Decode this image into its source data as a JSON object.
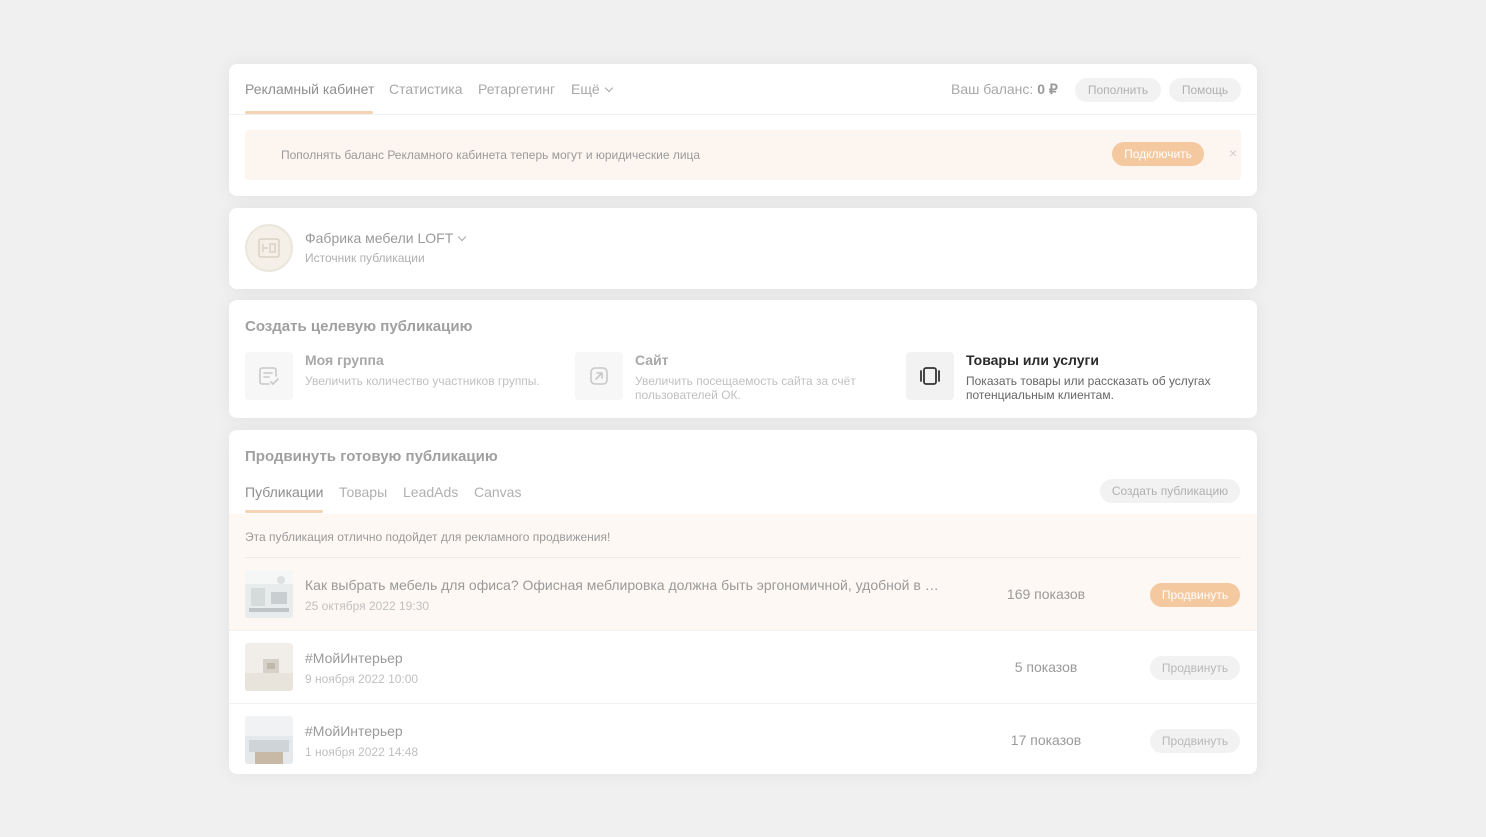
{
  "nav": {
    "tabs": [
      {
        "label": "Рекламный кабинет"
      },
      {
        "label": "Статистика"
      },
      {
        "label": "Ретаргетинг"
      },
      {
        "label": "Ещё"
      }
    ],
    "balance_label": "Ваш баланс:",
    "balance_value": "0 ₽",
    "topup_label": "Пополнить",
    "help_label": "Помощь"
  },
  "banner": {
    "text": "Пополнять баланс Рекламного кабинета теперь могут и юридические лица",
    "button_label": "Подключить",
    "close_glyph": "×"
  },
  "source": {
    "name": "Фабрика мебели LOFT",
    "subtitle": "Источник публикации"
  },
  "create": {
    "title": "Создать целевую публикацию",
    "options": [
      {
        "title": "Моя группа",
        "desc": "Увеличить количество участников группы.",
        "icon": "group-check-icon"
      },
      {
        "title": "Сайт",
        "desc": "Увеличить посещаемость сайта за счёт пользователей ОК.",
        "icon": "external-link-icon"
      },
      {
        "title": "Товары или услуги",
        "desc": "Показать товары или рассказать об услугах потенциальным клиентам.",
        "icon": "carousel-icon"
      }
    ]
  },
  "promote": {
    "title": "Продвинуть готовую публикацию",
    "tabs": [
      {
        "label": "Публикации"
      },
      {
        "label": "Товары"
      },
      {
        "label": "LeadAds"
      },
      {
        "label": "Canvas"
      }
    ],
    "create_button": "Создать публикацию",
    "hint": "Эта публикация отлично подойдет для рекламного продвижения!",
    "rows": [
      {
        "title": "Как выбрать мебель для офиса? Офисная меблировка должна быть эргономичной, удобной в …",
        "date": "25 октября 2022 19:30",
        "views": "169 показов",
        "button": "Продвинуть"
      },
      {
        "title": "#МойИнтерьер",
        "date": "9 ноября 2022 10:00",
        "views": "5 показов",
        "button": "Продвинуть"
      },
      {
        "title": "#МойИнтерьер",
        "date": "1 ноября 2022 14:48",
        "views": "17 показов",
        "button": "Продвинуть"
      }
    ]
  },
  "colors": {
    "accent": "#f5c9a0",
    "accent_underline": "#f6d3b2",
    "banner_bg": "#fdf6f0"
  }
}
